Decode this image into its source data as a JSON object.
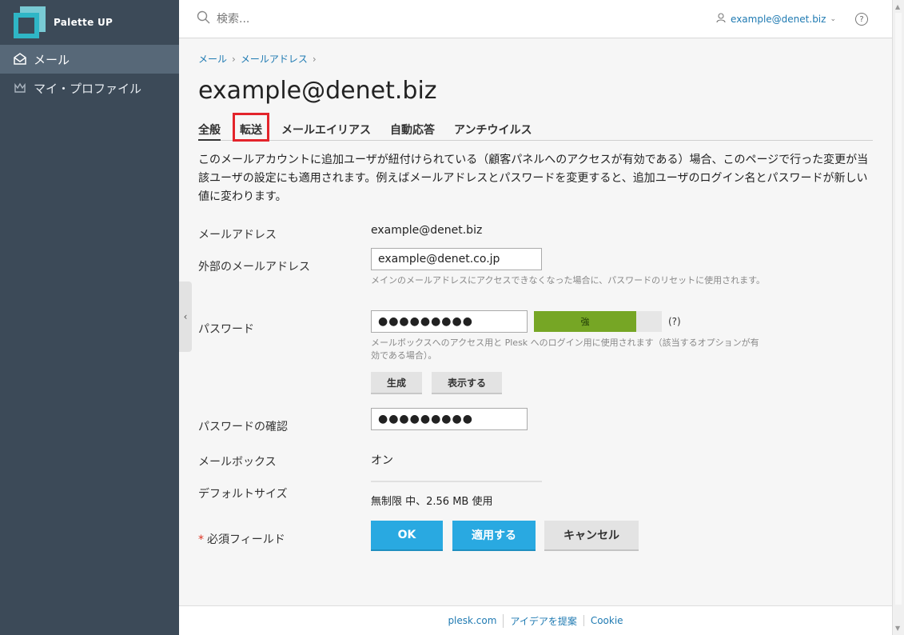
{
  "brand": {
    "name": "Palette UP"
  },
  "sidebar": {
    "items": [
      {
        "label": "メール",
        "icon": "mail-icon",
        "active": true
      },
      {
        "label": "マイ・プロファイル",
        "icon": "crown-icon",
        "active": false
      }
    ]
  },
  "topbar": {
    "search_placeholder": "検索...",
    "user": "example@denet.biz",
    "help": "?"
  },
  "breadcrumb": [
    "メール",
    "メールアドレス"
  ],
  "page_title": "example@denet.biz",
  "tabs": [
    {
      "label": "全般",
      "active": true
    },
    {
      "label": "転送",
      "highlighted": true
    },
    {
      "label": "メールエイリアス"
    },
    {
      "label": "自動応答"
    },
    {
      "label": "アンチウイルス"
    }
  ],
  "notice": "このメールアカウントに追加ユーザが紐付けられている（顧客パネルへのアクセスが有効である）場合、このページで行った変更が当該ユーザの設定にも適用されます。例えばメールアドレスとパスワードを変更すると、追加ユーザのログイン名とパスワードが新しい値に変わります。",
  "form": {
    "email_label": "メールアドレス",
    "email_value": "example@denet.biz",
    "external_label": "外部のメールアドレス",
    "external_value": "example@denet.co.jp",
    "external_hint": "メインのメールアドレスにアクセスできなくなった場合に、パスワードのリセットに使用されます。",
    "password_label": "パスワード",
    "password_value": "●●●●●●●●●",
    "strength_label": "強",
    "strength_level": 0.8,
    "strength_help": "(?)",
    "password_hint": "メールボックスへのアクセス用と Plesk へのログイン用に使用されます（該当するオプションが有効である場合）。",
    "generate_label": "生成",
    "show_label": "表示する",
    "confirm_label": "パスワードの確認",
    "confirm_value": "●●●●●●●●●",
    "mailbox_label": "メールボックス",
    "mailbox_value": "オン",
    "size_label": "デフォルトサイズ",
    "size_value": "無制限 中、2.56 MB 使用",
    "required_label": "必須フィールド",
    "required_star": "*",
    "ok_label": "OK",
    "apply_label": "適用する",
    "cancel_label": "キャンセル"
  },
  "footer": {
    "links": [
      "plesk.com",
      "アイデアを提案",
      "Cookie"
    ]
  },
  "colors": {
    "sidebar": "#3c4a58",
    "accent": "#29a9e1",
    "link": "#1f7ab2",
    "strength": "#76a625",
    "highlight": "#e3242b"
  }
}
